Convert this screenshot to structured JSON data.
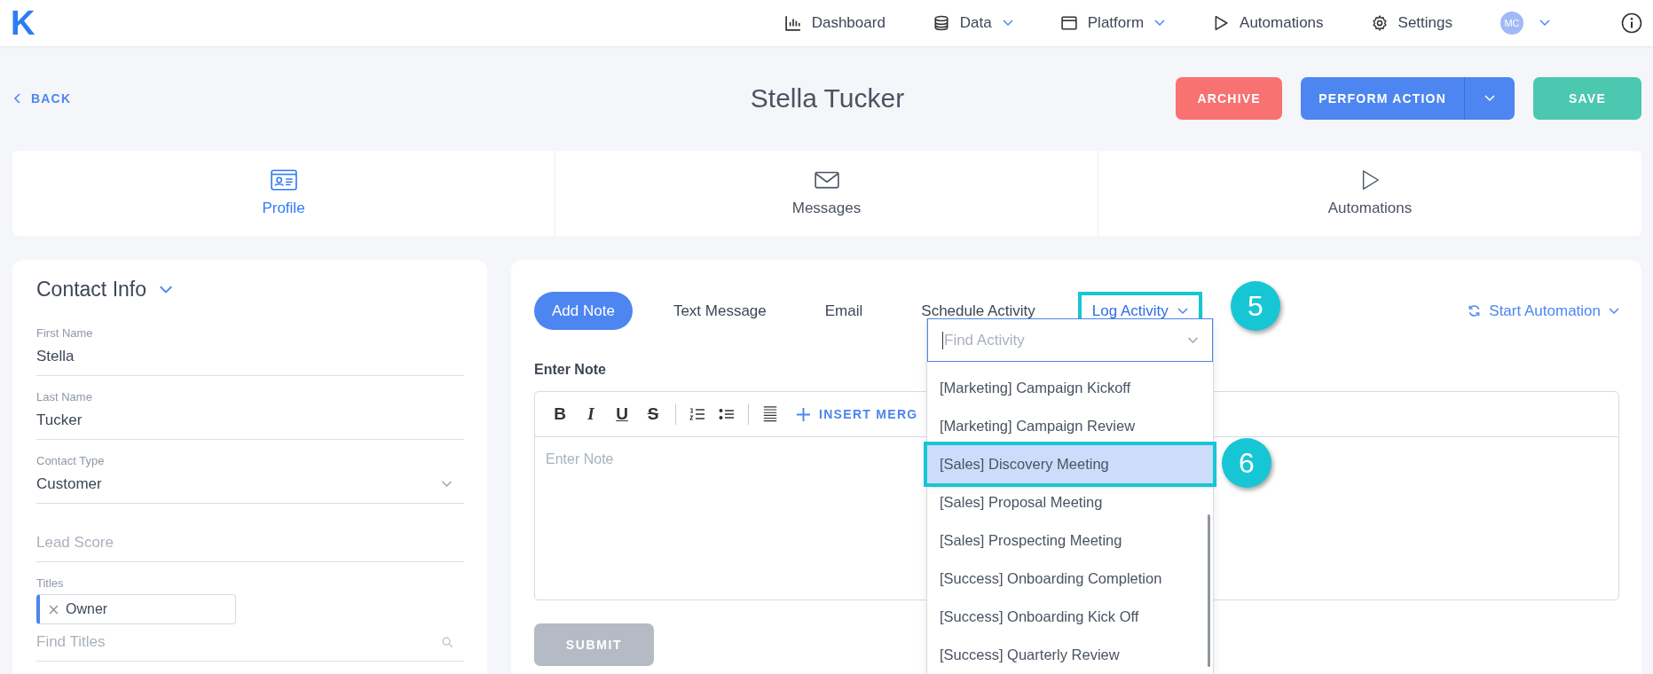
{
  "nav": {
    "logo": "K",
    "items": [
      {
        "label": "Dashboard",
        "dropdown": false
      },
      {
        "label": "Data",
        "dropdown": true
      },
      {
        "label": "Platform",
        "dropdown": true
      },
      {
        "label": "Automations",
        "dropdown": false
      },
      {
        "label": "Settings",
        "dropdown": false
      }
    ],
    "avatar": "MC"
  },
  "header": {
    "back": "BACK",
    "title": "Stella Tucker",
    "buttons": [
      {
        "label": "ARCHIVE",
        "kind": "archive"
      },
      {
        "label": "PERFORM ACTION",
        "kind": "split"
      },
      {
        "label": "SAVE",
        "kind": "save"
      }
    ]
  },
  "tabs": [
    {
      "label": "Profile",
      "selected": true
    },
    {
      "label": "Messages",
      "selected": false
    },
    {
      "label": "Automations",
      "selected": false
    }
  ],
  "contact": {
    "title": "Contact Info",
    "fields": [
      {
        "label": "First Name",
        "value": "Stella",
        "kind": "text"
      },
      {
        "label": "Last Name",
        "value": "Tucker",
        "kind": "text"
      },
      {
        "label": "Contact Type",
        "value": "Customer",
        "kind": "select"
      },
      {
        "placeholder": "Lead Score",
        "kind": "empty"
      },
      {
        "label": "Titles",
        "tags": [
          "Owner"
        ],
        "placeholder": "Find Titles",
        "kind": "tags"
      }
    ]
  },
  "composer": {
    "tabs": [
      {
        "label": "Add Note",
        "kind": "button",
        "selected": true,
        "highlighted": false
      },
      {
        "label": "Text Message",
        "kind": "button",
        "selected": false,
        "highlighted": false
      },
      {
        "label": "Email",
        "kind": "button",
        "selected": false,
        "highlighted": false
      },
      {
        "label": "Schedule Activity",
        "kind": "button",
        "selected": false,
        "highlighted": false
      },
      {
        "label": "Log Activity",
        "kind": "dropdown",
        "selected": false,
        "highlighted": true
      }
    ],
    "start_automation": "Start Automation",
    "note_label": "Enter Note",
    "toolbar": {
      "format": [
        "B",
        "I",
        "U",
        "S"
      ],
      "insert": "INSERT MERG"
    },
    "note_placeholder": "Enter Note",
    "submit": {
      "label": "SUBMIT",
      "disabled": true
    }
  },
  "activity_dropdown": {
    "placeholder": "Find Activity",
    "items": [
      {
        "label": "[Marketing] Campaign Kickoff",
        "selected": false,
        "highlighted": false
      },
      {
        "label": "[Marketing] Campaign Review",
        "selected": false,
        "highlighted": false
      },
      {
        "label": "[Sales] Discovery Meeting",
        "selected": true,
        "highlighted": true
      },
      {
        "label": "[Sales] Proposal Meeting",
        "selected": false,
        "highlighted": false
      },
      {
        "label": "[Sales] Prospecting Meeting",
        "selected": false,
        "highlighted": false
      },
      {
        "label": "[Success] Onboarding Completion",
        "selected": false,
        "highlighted": false
      },
      {
        "label": "[Success] Onboarding Kick Off",
        "selected": false,
        "highlighted": false
      },
      {
        "label": "[Success] Quarterly Review",
        "selected": false,
        "highlighted": false
      }
    ]
  },
  "callouts": [
    {
      "number": "5"
    },
    {
      "number": "6"
    }
  ]
}
